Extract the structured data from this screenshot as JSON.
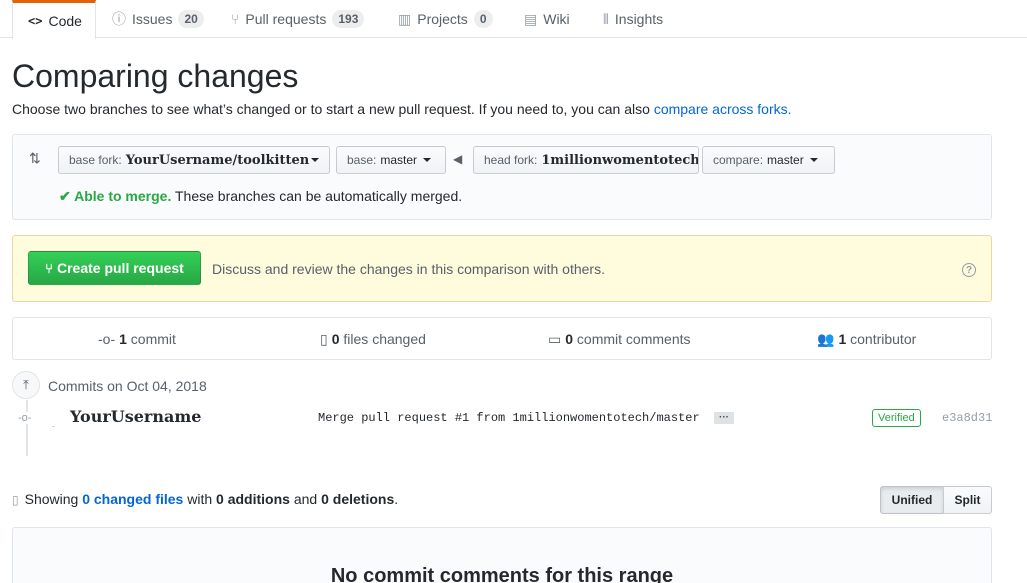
{
  "tabs": [
    {
      "label": "Code",
      "icon": "code-icon",
      "icon_glyph": "<>",
      "counter": null,
      "selected": true
    },
    {
      "label": "Issues",
      "icon": "issue-icon",
      "icon_glyph": "ⓘ",
      "counter": "20",
      "selected": false
    },
    {
      "label": "Pull requests",
      "icon": "pull-request-icon",
      "icon_glyph": "⑂",
      "counter": "193",
      "selected": false
    },
    {
      "label": "Projects",
      "icon": "project-icon",
      "icon_glyph": "▥",
      "counter": "0",
      "selected": false
    },
    {
      "label": "Wiki",
      "icon": "book-icon",
      "icon_glyph": "▤",
      "counter": null,
      "selected": false
    },
    {
      "label": "Insights",
      "icon": "graph-icon",
      "icon_glyph": "⫴",
      "counter": null,
      "selected": false
    }
  ],
  "page": {
    "title": "Comparing changes",
    "subtitle_text": "Choose two branches to see what’s changed or to start a new pull request. If you need to, you can also ",
    "subtitle_link": "compare across forks."
  },
  "range": {
    "base_fork_label": "base fork:",
    "base_fork_value": "YourUsername/toolkitten",
    "base_label": "base:",
    "base_value": "master",
    "head_fork_label": "head fork:",
    "head_fork_value": "1millionwomentotech",
    "compare_label": "compare:",
    "compare_value": "master",
    "merge_status": "✔ Able to merge.",
    "merge_detail": " These branches can be automatically merged."
  },
  "create_pr": {
    "button_label": "Create pull request",
    "description": "Discuss and review the changes in this comparison with others."
  },
  "summary": {
    "commits_count": "1",
    "commits_label": " commit",
    "files_count": "0",
    "files_label": " files changed",
    "comments_count": "0",
    "comments_label": " commit comments",
    "contributors_count": "1",
    "contributors_label": " contributor"
  },
  "commits": {
    "group_date": "Commits on Oct 04, 2018",
    "items": [
      {
        "author": "YourUsername",
        "message": "Merge pull request #1 from 1millionwomentotech/master",
        "verified": "Verified",
        "sha": "e3a8d31"
      }
    ]
  },
  "diff": {
    "showing": "Showing ",
    "changed_files": "0 changed files",
    "with": " with ",
    "additions": "0 additions",
    "and": " and ",
    "deletions": "0 deletions",
    "period": ".",
    "unified_label": "Unified",
    "split_label": "Split"
  },
  "blankslate": {
    "title": "No commit comments for this range"
  },
  "colors": {
    "accent_tab": "#e36209",
    "link": "#0366d6",
    "success": "#28a745",
    "pr_box_bg": "#fffbdd"
  }
}
